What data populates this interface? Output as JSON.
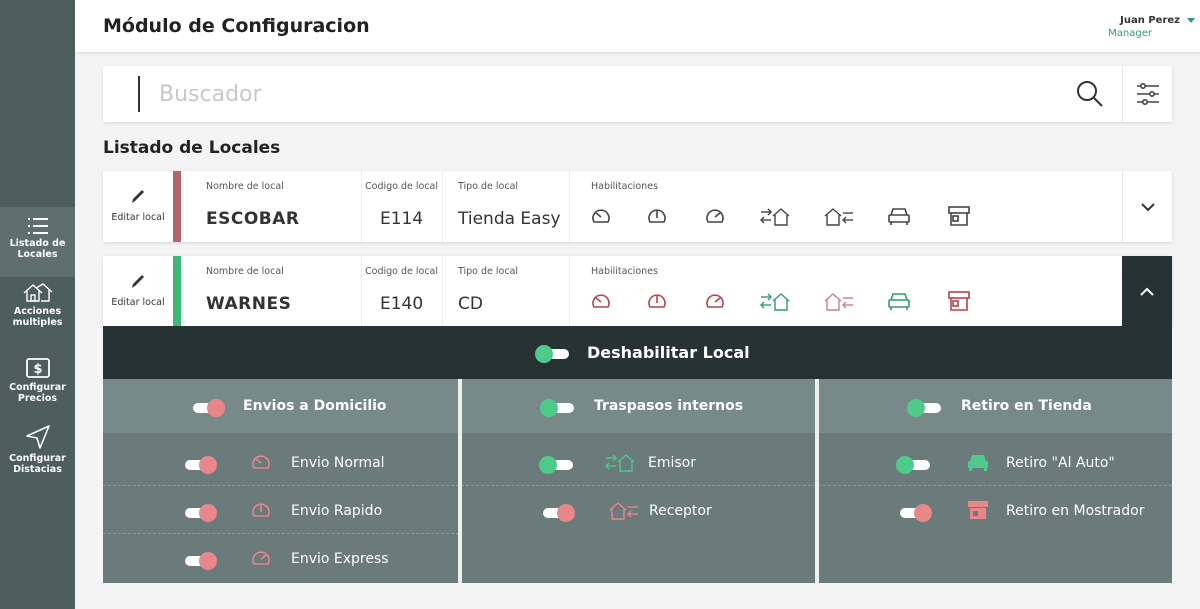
{
  "header": {
    "title": "Módulo de Configuracion",
    "user_name": "Juan Perez",
    "user_role": "Manager"
  },
  "sidebar": {
    "items": [
      {
        "label_1": "Listado de",
        "label_2": "Locales",
        "icon": "list-icon",
        "active": true
      },
      {
        "label_1": "Acciones",
        "label_2": "multiples",
        "icon": "houses-icon",
        "active": false
      },
      {
        "label_1": "Configurar",
        "label_2": "Precios",
        "icon": "dollar-icon",
        "active": false
      },
      {
        "label_1": "Configurar",
        "label_2": "Distacias",
        "icon": "send-icon",
        "active": false
      }
    ]
  },
  "search": {
    "placeholder": "Buscador"
  },
  "list": {
    "title": "Listado de Locales"
  },
  "column_labels": {
    "name": "Nombre de local",
    "code": "Codigo de local",
    "type": "Tipo de local",
    "habilitaciones": "Habilitaciones",
    "edit": "Editar local"
  },
  "locales": [
    {
      "name": "ESCOBAR",
      "code": "E114",
      "type": "Tienda Easy",
      "stripe_color": "#b5636a",
      "expanded": false
    },
    {
      "name": "WARNES",
      "code": "E140",
      "type": "CD",
      "stripe_color": "#3eb879",
      "expanded": true
    }
  ],
  "panel": {
    "disable_label": "Deshabilitar Local",
    "sections": [
      {
        "title": "Envios a Domicilio",
        "enabled": false,
        "options": [
          {
            "label": "Envio Normal",
            "enabled": false,
            "icon": "speedometer-low-icon"
          },
          {
            "label": "Envio Rapido",
            "enabled": false,
            "icon": "speedometer-mid-icon"
          },
          {
            "label": "Envio Express",
            "enabled": false,
            "icon": "speedometer-high-icon"
          }
        ]
      },
      {
        "title": "Traspasos internos",
        "enabled": true,
        "options": [
          {
            "label": "Emisor",
            "enabled": true,
            "icon": "house-out-icon"
          },
          {
            "label": "Receptor",
            "enabled": false,
            "icon": "house-in-icon"
          }
        ]
      },
      {
        "title": "Retiro en Tienda",
        "enabled": true,
        "options": [
          {
            "label": "Retiro \"Al Auto\"",
            "enabled": true,
            "icon": "car-icon"
          },
          {
            "label": "Retiro en Mostrador",
            "enabled": false,
            "icon": "store-icon"
          }
        ]
      }
    ]
  },
  "colors": {
    "accent_green": "#4ecb8b",
    "accent_red": "#e8878a",
    "dark": "#263234",
    "sidebar": "#4e5d5e"
  }
}
